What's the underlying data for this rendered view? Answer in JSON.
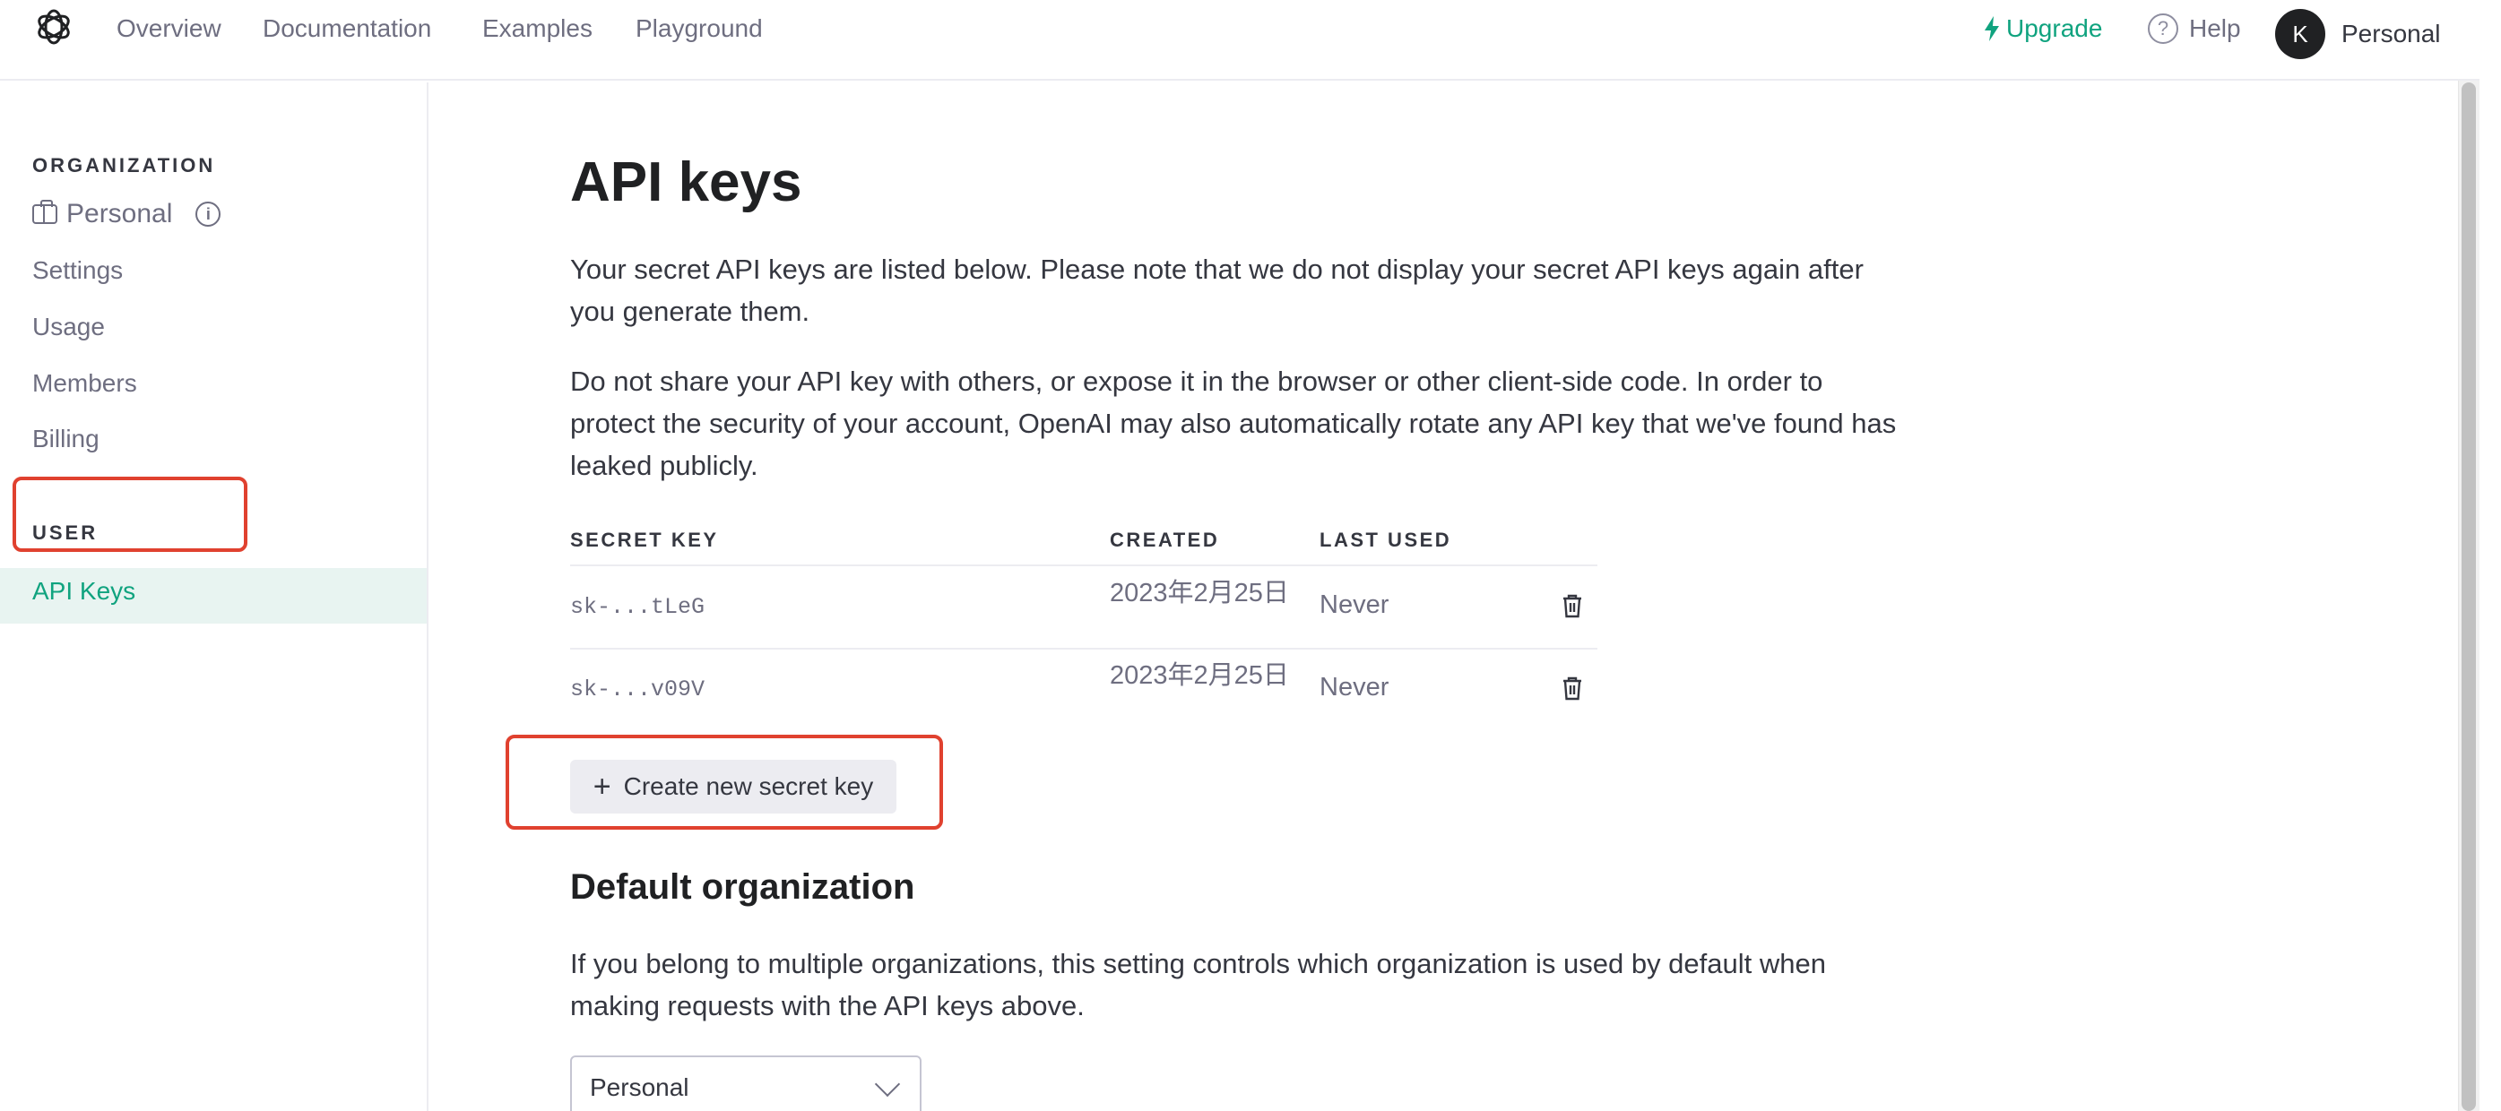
{
  "nav": {
    "links": [
      "Overview",
      "Documentation",
      "Examples",
      "Playground"
    ],
    "upgrade": "Upgrade",
    "help": "Help",
    "avatar_initial": "K",
    "account": "Personal",
    "brand_color": "#10a37f"
  },
  "sidebar": {
    "organization_label": "ORGANIZATION",
    "org_name": "Personal",
    "org_items": [
      "Settings",
      "Usage",
      "Members",
      "Billing"
    ],
    "user_label": "USER",
    "active_item": "API Keys"
  },
  "main": {
    "title": "API keys",
    "intro_1": "Your secret API keys are listed below. Please note that we do not display your secret API keys again after you generate them.",
    "intro_2": "Do not share your API key with others, or expose it in the browser or other client-side code. In order to protect the security of your account, OpenAI may also automatically rotate any API key that we've found has leaked publicly.",
    "table": {
      "headers": [
        "SECRET KEY",
        "CREATED",
        "LAST USED"
      ],
      "rows": [
        {
          "key": "sk-...tLeG",
          "created": "2023年2月25日",
          "last_used": "Never"
        },
        {
          "key": "sk-...v09V",
          "created": "2023年2月25日",
          "last_used": "Never"
        }
      ]
    },
    "create_button": "Create new secret key",
    "default_org_title": "Default organization",
    "default_org_desc": "If you belong to multiple organizations, this setting controls which organization is used by default when making requests with the API keys above.",
    "default_org_value": "Personal"
  }
}
